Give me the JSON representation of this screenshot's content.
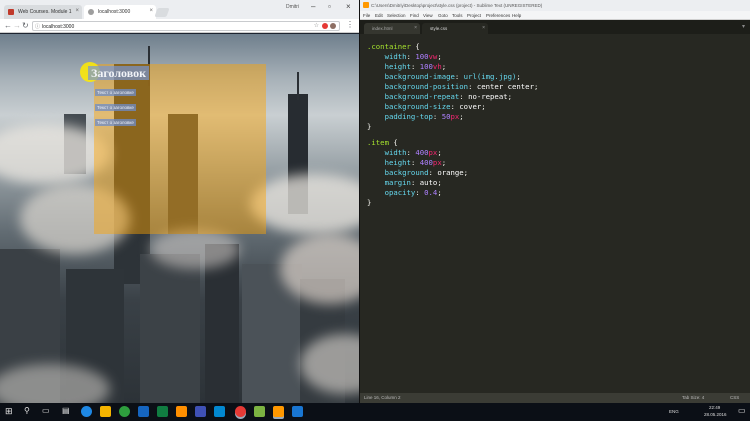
{
  "chrome": {
    "tabs": [
      {
        "title": "Web Courses. Module 1",
        "active": false
      },
      {
        "title": "localhost:3000",
        "active": true
      }
    ],
    "user_label": "Dmitri",
    "address": "localhost:3000"
  },
  "page": {
    "heading": "Заголовок",
    "texts": [
      "Текст о заголовке",
      "Текст о заголовке",
      "Текст о заголовке"
    ]
  },
  "sublime": {
    "window_title": "C:\\Users\\Dmitriy\\Desktop\\project\\style.css (project) - Sublime Text (UNREGISTERED)",
    "menu": [
      "File",
      "Edit",
      "Selection",
      "Find",
      "View",
      "Goto",
      "Tools",
      "Project",
      "Preferences",
      "Help"
    ],
    "tabs": [
      {
        "title": "index.html",
        "active": false
      },
      {
        "title": "style.css",
        "active": true
      }
    ],
    "code": {
      "container_selector": ".container",
      "open_brace": "{",
      "close_brace": "}",
      "item_selector": ".item",
      "rules_container": [
        {
          "prop": "width",
          "num": "100",
          "unit": "vw"
        },
        {
          "prop": "height",
          "num": "100",
          "unit": "vh"
        },
        {
          "prop": "background-image",
          "value": "url(img.jpg)"
        },
        {
          "prop": "background-position",
          "value": "center center"
        },
        {
          "prop": "background-repeat",
          "value": "no-repeat"
        },
        {
          "prop": "background-size",
          "value": "cover"
        },
        {
          "prop": "padding-top",
          "num": "50",
          "unit": "px"
        }
      ],
      "rules_item": [
        {
          "prop": "width",
          "num": "400",
          "unit": "px"
        },
        {
          "prop": "height",
          "num": "400",
          "unit": "px"
        },
        {
          "prop": "background",
          "value": "orange"
        },
        {
          "prop": "margin",
          "value": "auto"
        },
        {
          "prop": "opacity",
          "num": "0.4"
        }
      ]
    },
    "status_left": "Line 16, Column 2",
    "status_tab": "Tab Size: 4",
    "status_syntax": "CSS"
  },
  "taskbar": {
    "lang": "ENG",
    "time": "22:49",
    "date": "28.05.2016"
  },
  "colors": {
    "item_orange": "#ffa500",
    "editor_bg": "#272822",
    "keyword_pink": "#f92672",
    "selector_green": "#a6e22e",
    "property_blue": "#66d9ef",
    "number_purple": "#ae81ff"
  }
}
